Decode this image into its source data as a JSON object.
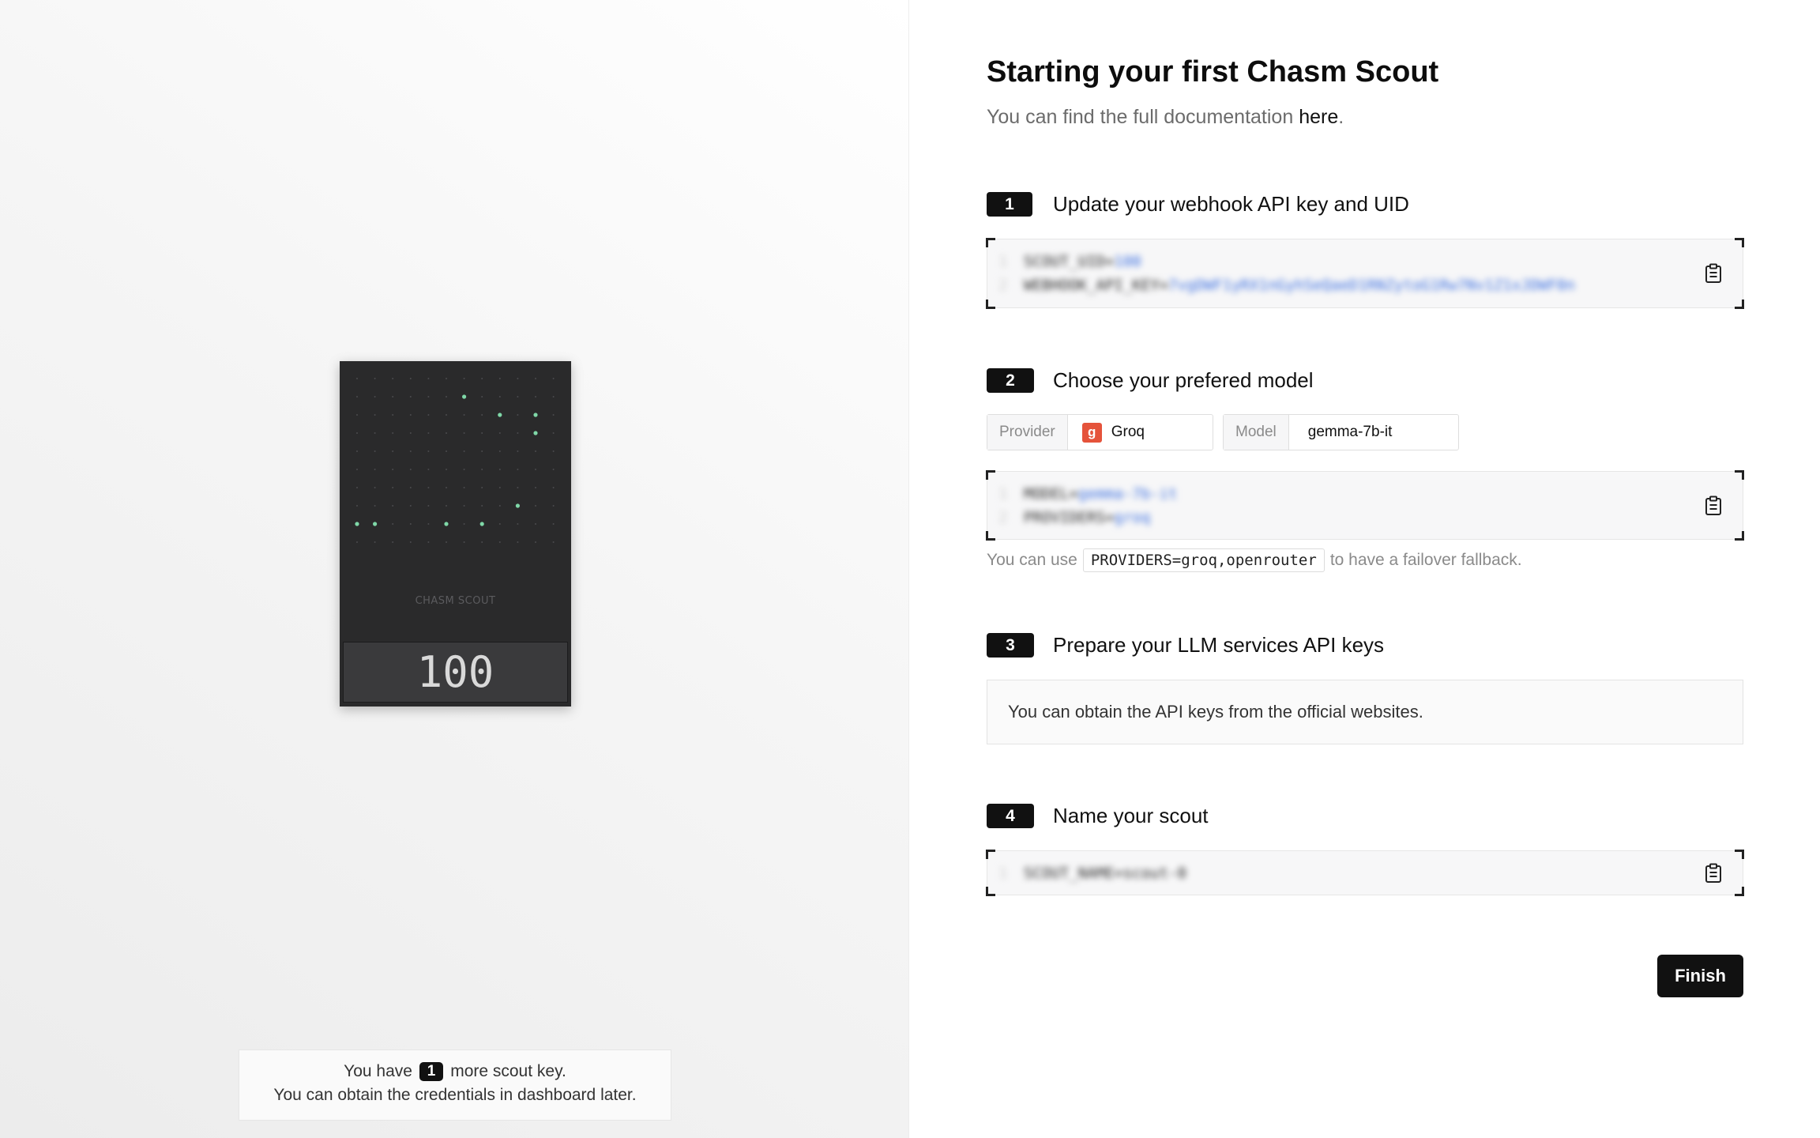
{
  "header": {
    "title": "Starting your first Chasm Scout",
    "subtitle_prefix": "You can find the full documentation",
    "subtitle_link": "here",
    "subtitle_suffix": "."
  },
  "device": {
    "brand": "CHASM SCOUT",
    "display_value": "100"
  },
  "key_note": {
    "line1_prefix": "You have",
    "count": "1",
    "line1_suffix": "more scout key.",
    "line2": "You can obtain the credentials in dashboard later."
  },
  "steps": [
    {
      "number": "1",
      "title": "Update your webhook API key and UID",
      "code": [
        {
          "line": "1",
          "key": "SCOUT_UID=",
          "value": "100"
        },
        {
          "line": "2",
          "key": "WEBHOOK_API_KEY=",
          "value": "7vgDWF1yRX1nGyhSeQaeD1RNZytoG1Rw7Nv1Z1xJDWF0n"
        }
      ]
    },
    {
      "number": "2",
      "title": "Choose your prefered model",
      "provider_label": "Provider",
      "provider_value": "Groq",
      "provider_icon": "groq-logo",
      "model_label": "Model",
      "model_value": "gemma-7b-it",
      "code": [
        {
          "line": "1",
          "key": "MODEL=",
          "value": "gemma-7b-it"
        },
        {
          "line": "2",
          "key": "PROVIDERS=",
          "value": "groq"
        }
      ],
      "hint_prefix": "You can use",
      "hint_code": "PROVIDERS=groq,openrouter",
      "hint_suffix": "to have a failover fallback."
    },
    {
      "number": "3",
      "title": "Prepare your LLM services API keys",
      "info": "You can obtain the API keys from the official websites."
    },
    {
      "number": "4",
      "title": "Name your scout",
      "code": [
        {
          "line": "1",
          "key": "SCOUT_NAME=scout-0",
          "value": ""
        }
      ]
    }
  ],
  "finish_label": "Finish",
  "icons": {
    "copy": "clipboard-icon",
    "groq": "groq-logo-icon"
  },
  "colors": {
    "accent": "#111111",
    "groq": "#e5533b",
    "code_value": "#3b6fe0",
    "led": "#7fd8a8"
  }
}
